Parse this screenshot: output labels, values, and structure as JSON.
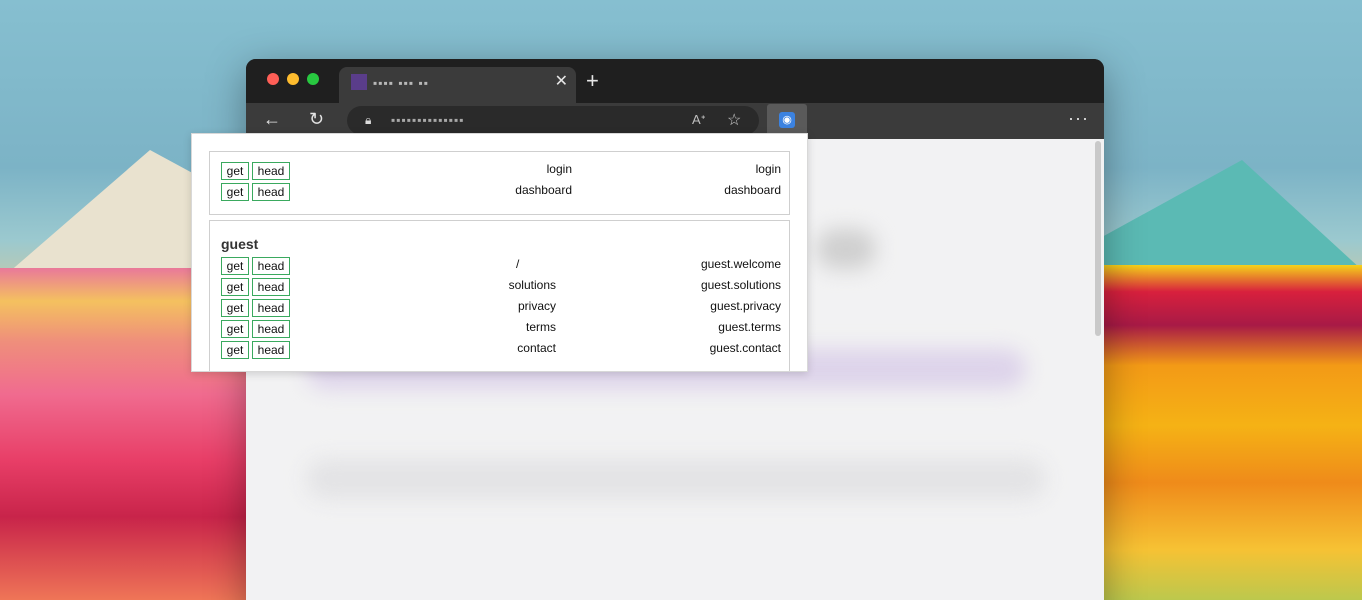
{
  "browser": {
    "tab": {
      "title": "▪▪▪▪ ▪▪▪ ▪▪"
    },
    "address_bar": {
      "url": "▪▪▪▪▪▪▪▪▪▪▪▪▪▪"
    }
  },
  "routes_popup": {
    "groups": [
      {
        "title": "",
        "routes": [
          {
            "methods": [
              "get",
              "head"
            ],
            "uri": "login",
            "name": "login"
          },
          {
            "methods": [
              "get",
              "head"
            ],
            "uri": "dashboard",
            "name": "dashboard"
          }
        ]
      },
      {
        "title": "guest",
        "routes": [
          {
            "methods": [
              "get",
              "head"
            ],
            "uri": "/",
            "name": "guest.welcome"
          },
          {
            "methods": [
              "get",
              "head"
            ],
            "uri": "solutions",
            "name": "guest.solutions"
          },
          {
            "methods": [
              "get",
              "head"
            ],
            "uri": "privacy",
            "name": "guest.privacy"
          },
          {
            "methods": [
              "get",
              "head"
            ],
            "uri": "terms",
            "name": "guest.terms"
          },
          {
            "methods": [
              "get",
              "head"
            ],
            "uri": "contact",
            "name": "guest.contact"
          }
        ]
      }
    ]
  },
  "icons": {
    "back": "arrow-left-icon",
    "reload": "reload-icon",
    "lock": "lock-icon",
    "read_aloud": "read-aloud-icon",
    "favorites": "favorites-icon",
    "extension": "extension-icon",
    "more": "more-icon",
    "close": "close-icon",
    "new_tab": "plus-icon"
  },
  "colors": {
    "method_border": "#3aa95e",
    "traffic_red": "#ff5f57",
    "traffic_yellow": "#febc2e",
    "traffic_green": "#28c840"
  }
}
